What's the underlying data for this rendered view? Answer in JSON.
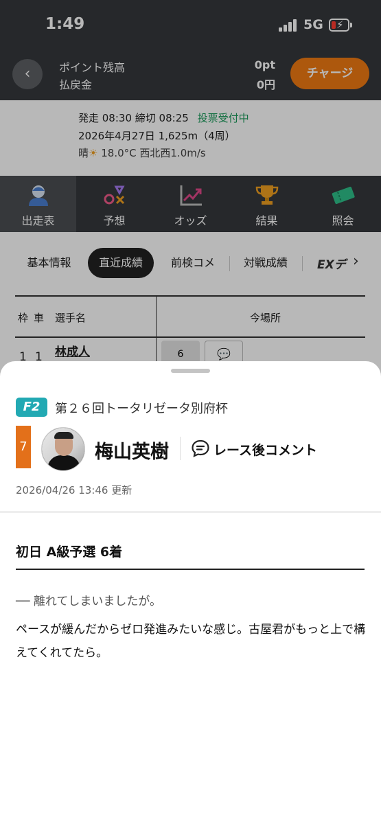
{
  "status_bar": {
    "time": "1:49",
    "network": "5G"
  },
  "header": {
    "point_label": "ポイント残高",
    "point_value": "0pt",
    "payout_label": "払戻金",
    "payout_value": "0円",
    "charge_button": "チャージ"
  },
  "race_info": {
    "start": "発走 08:30",
    "close": "締切 08:25",
    "status": "投票受付中",
    "date_distance": "2026年4月27日 1,625m（4周）",
    "weather": "晴",
    "weather_detail": "18.0°C 西北西1.0m/s"
  },
  "tabs": [
    {
      "label": "出走表",
      "icon": "rider-icon"
    },
    {
      "label": "予想",
      "icon": "prediction-icon"
    },
    {
      "label": "オッズ",
      "icon": "odds-chart-icon"
    },
    {
      "label": "結果",
      "icon": "trophy-icon"
    },
    {
      "label": "照会",
      "icon": "ticket-icon"
    }
  ],
  "subtabs": [
    {
      "label": "基本情報"
    },
    {
      "label": "直近成績"
    },
    {
      "label": "前検コメ"
    },
    {
      "label": "対戦成績"
    },
    {
      "label": "EXデ"
    }
  ],
  "table": {
    "headers": {
      "frame": "枠",
      "car": "車",
      "name": "選手名",
      "venue": "今場所"
    },
    "row": {
      "frame": "1",
      "car": "1",
      "name": "林成人",
      "result": "6"
    }
  },
  "sheet": {
    "grade": "F2",
    "race_title": "第２６回トータリゼータ別府杯",
    "bracket_number": "7",
    "rider_name": "梅山英樹",
    "comment_label": "レース後コメント",
    "updated": "2026/04/26 13:46 更新",
    "section_title": "初日 A級予選 6着",
    "question": "── 離れてしまいましたが。",
    "answer": "ペースが緩んだからゼロ発進みたいな感じ。古屋君がもっと上で構えてくれてたら。"
  },
  "colors": {
    "accent_orange": "#f07a12",
    "status_green": "#1a9a5a",
    "grade_teal": "#22a9b3",
    "bracket_orange": "#e3701a"
  }
}
